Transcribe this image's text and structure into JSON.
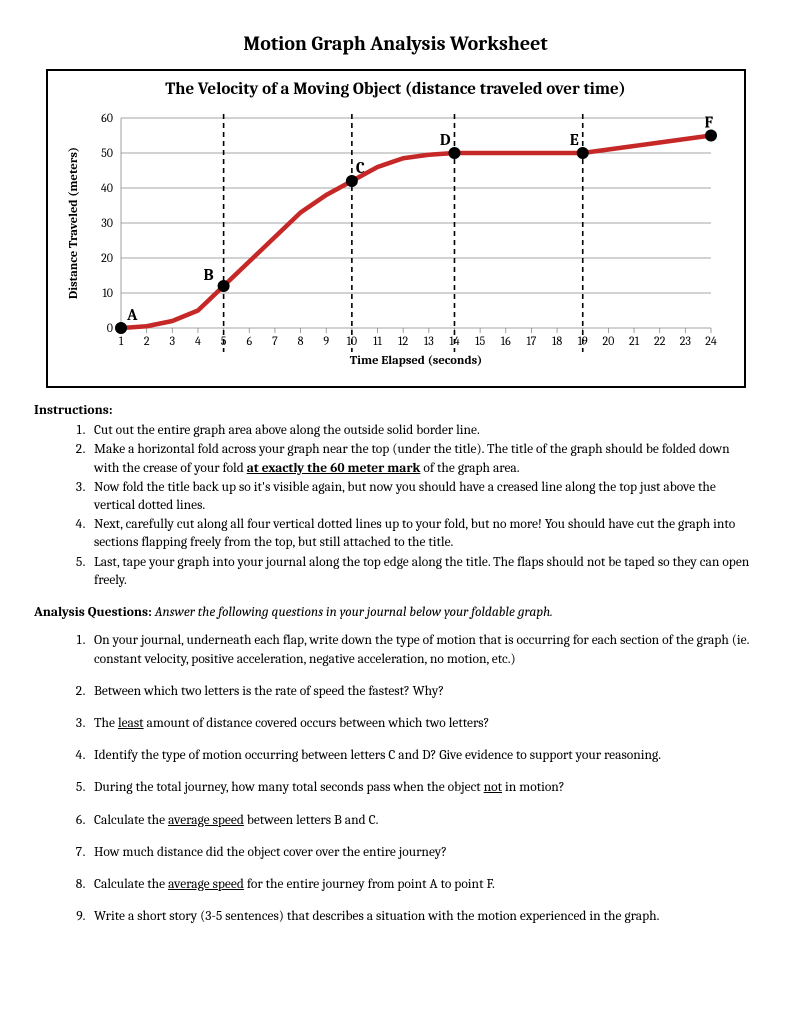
{
  "title": "Motion Graph Analysis Worksheet",
  "chart_data": {
    "type": "line",
    "title": "The Velocity of a Moving Object (distance traveled over time)",
    "xlabel": "Time Elapsed (seconds)",
    "ylabel": "Distance Traveled (meters)",
    "xlim": [
      1,
      24
    ],
    "ylim": [
      0,
      60
    ],
    "x_ticks": [
      1,
      2,
      3,
      4,
      5,
      6,
      7,
      8,
      9,
      10,
      11,
      12,
      13,
      14,
      15,
      16,
      17,
      18,
      19,
      20,
      21,
      22,
      23,
      24
    ],
    "y_ticks": [
      0,
      10,
      20,
      30,
      40,
      50,
      60
    ],
    "vertical_cuts": [
      5,
      10,
      14,
      19
    ],
    "series": [
      {
        "name": "distance",
        "x": [
          1,
          2,
          3,
          4,
          5,
          6,
          7,
          8,
          9,
          10,
          11,
          12,
          13,
          14,
          15,
          16,
          17,
          18,
          19,
          20,
          21,
          22,
          23,
          24
        ],
        "values": [
          0,
          0.5,
          2,
          5,
          12,
          19,
          26,
          33,
          38,
          42,
          46,
          48.5,
          49.5,
          50,
          50,
          50,
          50,
          50,
          50,
          51,
          52,
          53,
          54,
          55
        ]
      }
    ],
    "labeled_points": [
      {
        "label": "A",
        "x": 1,
        "y": 0
      },
      {
        "label": "B",
        "x": 5,
        "y": 12
      },
      {
        "label": "C",
        "x": 10,
        "y": 42
      },
      {
        "label": "D",
        "x": 14,
        "y": 50
      },
      {
        "label": "E",
        "x": 19,
        "y": 50
      },
      {
        "label": "F",
        "x": 24,
        "y": 55
      }
    ]
  },
  "instructions_heading": "Instructions:",
  "instructions": {
    "i1": "Cut out the entire graph area above along the outside solid border line.",
    "i2a": "Make a horizontal fold across your graph near the top (under the title).  The title of the graph should be folded down with the crease of your fold ",
    "i2b": "at exactly the 60 meter mark",
    "i2c": " of the graph area.",
    "i3": "Now fold the title back up so it's visible again, but now you should have a creased line along the top just above the vertical dotted lines.",
    "i4": "Next, carefully cut along all four vertical dotted lines up to your fold, but no more!  You should have cut the graph into sections flapping freely from the top, but still attached to the title.",
    "i5": "Last, tape your graph into your journal along the top edge along the title.  The flaps should not be taped so they can open freely."
  },
  "analysis_heading": "Analysis Questions:",
  "analysis_intro": "  Answer the following questions in your journal below your foldable graph.",
  "questions": {
    "q1": "On your journal, underneath each flap, write down the type of motion that is occurring for each section of the graph (ie. constant velocity, positive acceleration, negative acceleration, no motion, etc.)",
    "q2": "Between which two letters is the rate of speed the fastest?  Why?",
    "q3a": "The ",
    "q3b": "least",
    "q3c": " amount of distance covered occurs between which two letters?",
    "q4": "Identify the type of motion occurring between letters C and D?  Give evidence to support your reasoning.",
    "q5a": "During the total journey, how many total seconds pass when the object ",
    "q5b": "not",
    "q5c": " in motion?",
    "q6a": "Calculate the ",
    "q6b": "average speed",
    "q6c": " between letters B and C.",
    "q7": "How much distance did the object cover over the entire journey?",
    "q8a": "Calculate the ",
    "q8b": "average speed",
    "q8c": " for the entire journey from point A to point F.",
    "q9": "Write a short story (3-5 sentences) that describes a situation with the motion experienced in the graph."
  }
}
